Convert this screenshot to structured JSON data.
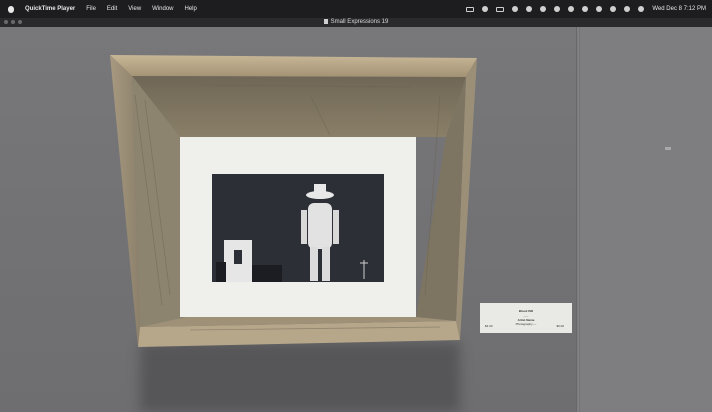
{
  "menubar": {
    "app_name": "QuickTime Player",
    "items": [
      "File",
      "Edit",
      "View",
      "Window",
      "Help"
    ],
    "clock": "Wed Dec 8   7:12 PM"
  },
  "window": {
    "title": "Small Expressions 19"
  },
  "artwork_label": {
    "line1": "Blood ISD",
    "line2": "-- --",
    "line3": "Artist Name",
    "line4": "Photography ---",
    "price_left": "$4.00",
    "price_right": "$0.00"
  },
  "colors": {
    "menubar": "#1d1d20",
    "wall": "#747476",
    "mat": "#f2f2ee",
    "frame_wood": "#b8a98c"
  }
}
